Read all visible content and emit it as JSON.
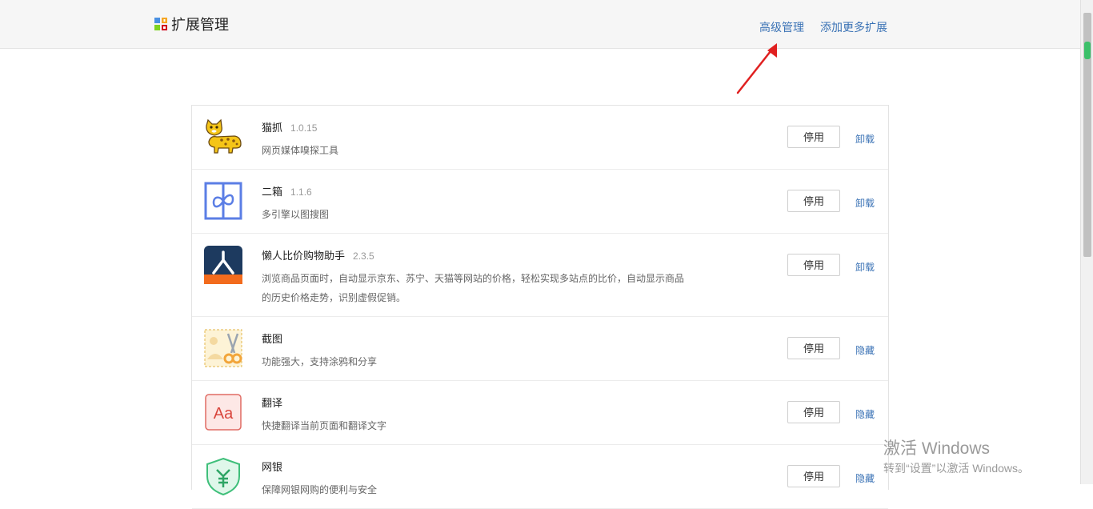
{
  "header": {
    "title": "扩展管理",
    "advanced_link": "高级管理",
    "add_more_link": "添加更多扩展"
  },
  "extensions": [
    {
      "name": "猫抓",
      "version": "1.0.15",
      "description": "网页媒体嗅探工具",
      "button": "停用",
      "action": "卸载",
      "icon": "cat-icon"
    },
    {
      "name": "二箱",
      "version": "1.1.6",
      "description": "多引擎以图搜图",
      "button": "停用",
      "action": "卸载",
      "icon": "infinity-box-icon"
    },
    {
      "name": "懒人比价购物助手",
      "version": "2.3.5",
      "description": "浏览商品页面时，自动显示京东、苏宁、天猫等网站的价格，轻松实现多站点的比价，自动显示商品的历史价格走势，识别虚假促销。",
      "button": "停用",
      "action": "卸载",
      "icon": "price-compare-icon"
    },
    {
      "name": "截图",
      "version": "",
      "description": "功能强大，支持涂鸦和分享",
      "button": "停用",
      "action": "隐藏",
      "icon": "scissors-icon"
    },
    {
      "name": "翻译",
      "version": "",
      "description": "快捷翻译当前页面和翻译文字",
      "button": "停用",
      "action": "隐藏",
      "icon": "translate-aa-icon"
    },
    {
      "name": "网银",
      "version": "",
      "description": "保障网银网购的便利与安全",
      "button": "停用",
      "action": "隐藏",
      "icon": "yuan-shield-icon"
    }
  ],
  "watermark": {
    "title": "激活 Windows",
    "subtitle": "转到“设置”以激活 Windows。"
  },
  "colors": {
    "link": "#3a72b5",
    "arrow": "#e02020",
    "scroll_indicator": "#3cc06a"
  }
}
